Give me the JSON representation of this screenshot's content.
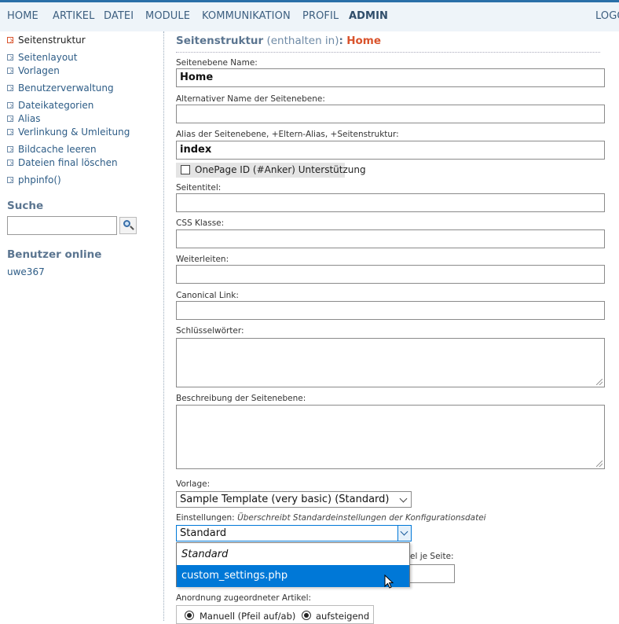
{
  "topnav": {
    "items": [
      "HOME",
      "ARTIKEL",
      "DATEI",
      "MODULE",
      "KOMMUNIKATION",
      "PROFIL",
      "ADMIN",
      "LOGO"
    ],
    "active": "ADMIN"
  },
  "sidebar": {
    "links": [
      "Seitenstruktur",
      "Seitenlayout",
      "Vorlagen",
      "Benutzerverwaltung",
      "Dateikategorien",
      "Alias",
      "Verlinkung & Umleitung",
      "Bildcache leeren",
      "Dateien final löschen",
      "phpinfo()"
    ],
    "current": "Seitenstruktur",
    "search_heading": "Suche",
    "search_value": "",
    "online_heading": "Benutzer online",
    "online_user": "uwe367"
  },
  "main": {
    "title_part1": "Seitenstruktur",
    "title_part2": "(enthalten in)",
    "title_colon": ":",
    "title_page": "Home",
    "fields": {
      "name_label": "Seitenebene Name:",
      "name_value": "Home",
      "altname_label": "Alternativer Name der Seitenebene:",
      "altname_value": "",
      "alias_label": "Alias der Seitenebene, +Eltern-Alias, +Seitenstruktur:",
      "alias_value": "index",
      "onepage_label": "OnePage ID (#Anker) Unterstützung",
      "title_label": "Seitentitel:",
      "title_value": "",
      "css_label": "CSS Klasse:",
      "css_value": "",
      "redirect_label": "Weiterleiten:",
      "redirect_value": "",
      "canonical_label": "Canonical Link:",
      "canonical_value": "",
      "keywords_label": "Schlüsselwörter:",
      "description_label": "Beschreibung der Seitenebene:",
      "template_label": "Vorlage:",
      "template_value": "Sample Template (very basic) (Standard)",
      "settings_label": "Einstellungen:",
      "settings_hint": "Überschreibt Standardeinstellungen der Konfigurationsdatei",
      "settings_value": "Standard",
      "settings_options": [
        "Standard",
        "custom_settings.php"
      ],
      "settings_highlighted": "custom_settings.php",
      "per_page_label_partial": "el je Seite:",
      "order_label": "Anordnung zugeordneter Artikel:",
      "order_option_1": "Manuell (Pfeil auf/ab)",
      "order_option_2": "aufsteigend"
    }
  }
}
